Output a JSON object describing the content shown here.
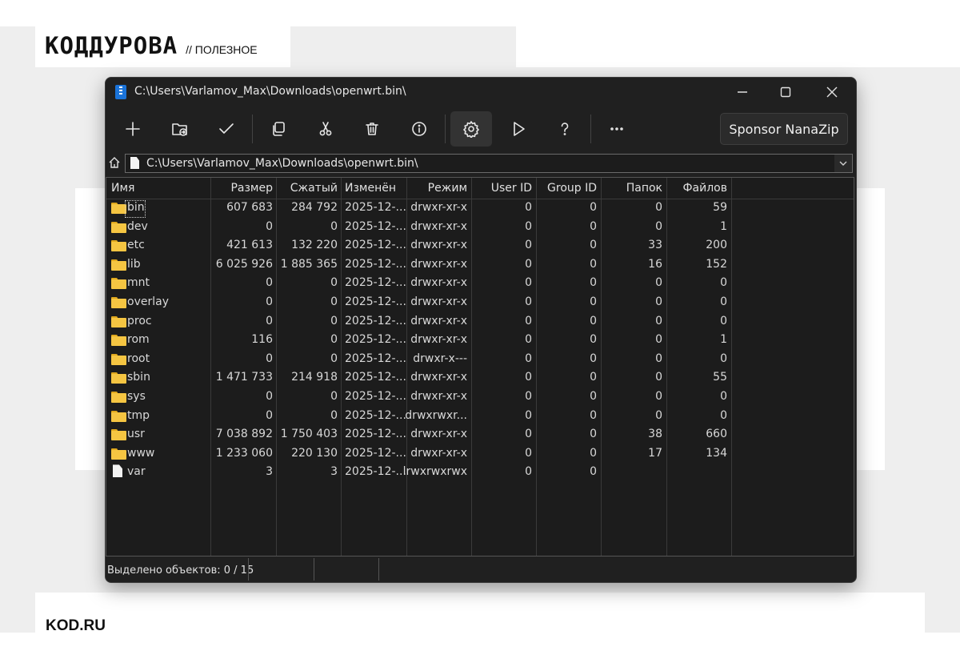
{
  "brand": {
    "logo": "КОДДУРОВА",
    "tag": "// ПОЛЕЗНОЕ",
    "footer": "KOD.RU"
  },
  "window": {
    "title": "C:\\Users\\Varlamov_Max\\Downloads\\openwrt.bin\\",
    "controls": [
      "minimize-icon",
      "maximize-icon",
      "close-icon"
    ]
  },
  "toolbar": {
    "icons": [
      "plus-icon",
      "folder-extract-icon",
      "check-icon",
      "copy-icon",
      "cut-icon",
      "delete-icon",
      "info-icon",
      "gear-icon",
      "play-icon",
      "help-icon",
      "more-icon"
    ],
    "sponsor_label": "Sponsor NanaZip"
  },
  "address": {
    "path": "C:\\Users\\Varlamov_Max\\Downloads\\openwrt.bin\\"
  },
  "columns": [
    "Имя",
    "Размер",
    "Сжатый",
    "Изменён",
    "Режим",
    "User ID",
    "Group ID",
    "Папок",
    "Файлов"
  ],
  "rows": [
    {
      "name": "bin",
      "size": "607 683",
      "packed": "284 792",
      "modified": "2025-12-...",
      "mode": "drwxr-xr-x",
      "uid": "0",
      "gid": "0",
      "folders": "0",
      "files": "59",
      "type": "folder"
    },
    {
      "name": "dev",
      "size": "0",
      "packed": "0",
      "modified": "2025-12-...",
      "mode": "drwxr-xr-x",
      "uid": "0",
      "gid": "0",
      "folders": "0",
      "files": "1",
      "type": "folder"
    },
    {
      "name": "etc",
      "size": "421 613",
      "packed": "132 220",
      "modified": "2025-12-...",
      "mode": "drwxr-xr-x",
      "uid": "0",
      "gid": "0",
      "folders": "33",
      "files": "200",
      "type": "folder"
    },
    {
      "name": "lib",
      "size": "6 025 926",
      "packed": "1 885 365",
      "modified": "2025-12-...",
      "mode": "drwxr-xr-x",
      "uid": "0",
      "gid": "0",
      "folders": "16",
      "files": "152",
      "type": "folder"
    },
    {
      "name": "mnt",
      "size": "0",
      "packed": "0",
      "modified": "2025-12-...",
      "mode": "drwxr-xr-x",
      "uid": "0",
      "gid": "0",
      "folders": "0",
      "files": "0",
      "type": "folder"
    },
    {
      "name": "overlay",
      "size": "0",
      "packed": "0",
      "modified": "2025-12-...",
      "mode": "drwxr-xr-x",
      "uid": "0",
      "gid": "0",
      "folders": "0",
      "files": "0",
      "type": "folder"
    },
    {
      "name": "proc",
      "size": "0",
      "packed": "0",
      "modified": "2025-12-...",
      "mode": "drwxr-xr-x",
      "uid": "0",
      "gid": "0",
      "folders": "0",
      "files": "0",
      "type": "folder"
    },
    {
      "name": "rom",
      "size": "116",
      "packed": "0",
      "modified": "2025-12-...",
      "mode": "drwxr-xr-x",
      "uid": "0",
      "gid": "0",
      "folders": "0",
      "files": "1",
      "type": "folder"
    },
    {
      "name": "root",
      "size": "0",
      "packed": "0",
      "modified": "2025-12-...",
      "mode": "drwxr-x---",
      "uid": "0",
      "gid": "0",
      "folders": "0",
      "files": "0",
      "type": "folder"
    },
    {
      "name": "sbin",
      "size": "1 471 733",
      "packed": "214 918",
      "modified": "2025-12-...",
      "mode": "drwxr-xr-x",
      "uid": "0",
      "gid": "0",
      "folders": "0",
      "files": "55",
      "type": "folder"
    },
    {
      "name": "sys",
      "size": "0",
      "packed": "0",
      "modified": "2025-12-...",
      "mode": "drwxr-xr-x",
      "uid": "0",
      "gid": "0",
      "folders": "0",
      "files": "0",
      "type": "folder"
    },
    {
      "name": "tmp",
      "size": "0",
      "packed": "0",
      "modified": "2025-12-...",
      "mode": "drwxrwxr...",
      "uid": "0",
      "gid": "0",
      "folders": "0",
      "files": "0",
      "type": "folder"
    },
    {
      "name": "usr",
      "size": "7 038 892",
      "packed": "1 750 403",
      "modified": "2025-12-...",
      "mode": "drwxr-xr-x",
      "uid": "0",
      "gid": "0",
      "folders": "38",
      "files": "660",
      "type": "folder"
    },
    {
      "name": "www",
      "size": "1 233 060",
      "packed": "220 130",
      "modified": "2025-12-...",
      "mode": "drwxr-xr-x",
      "uid": "0",
      "gid": "0",
      "folders": "17",
      "files": "134",
      "type": "folder"
    },
    {
      "name": "var",
      "size": "3",
      "packed": "3",
      "modified": "2025-12-...",
      "mode": "lrwxrwxrwx",
      "uid": "0",
      "gid": "0",
      "folders": "",
      "files": "",
      "type": "file"
    }
  ],
  "status": {
    "selected": "Выделено объектов: 0 / 15"
  }
}
